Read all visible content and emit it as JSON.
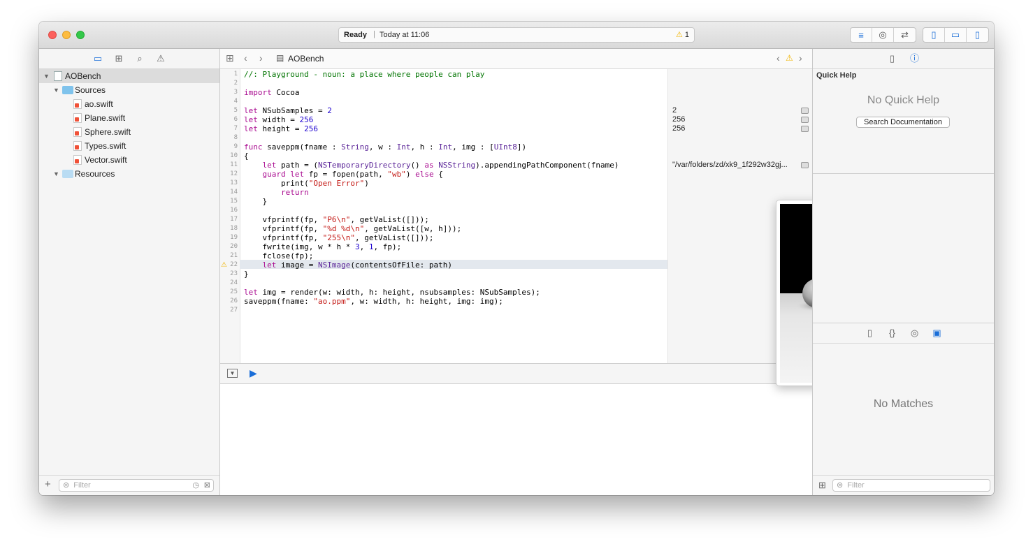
{
  "titlebar": {
    "status_ready": "Ready",
    "status_time": "Today at 11:06",
    "warning_count": "1"
  },
  "navigator": {
    "items": [
      {
        "label": "AOBench",
        "type": "project"
      },
      {
        "label": "Sources",
        "type": "folder"
      },
      {
        "label": "ao.swift",
        "type": "swift"
      },
      {
        "label": "Plane.swift",
        "type": "swift"
      },
      {
        "label": "Sphere.swift",
        "type": "swift"
      },
      {
        "label": "Types.swift",
        "type": "swift"
      },
      {
        "label": "Vector.swift",
        "type": "swift"
      },
      {
        "label": "Resources",
        "type": "folder"
      }
    ],
    "filter_placeholder": "Filter"
  },
  "editor": {
    "jumpbar_file": "AOBench",
    "lines": [
      "//: Playground - noun: a place where people can play",
      "",
      "import Cocoa",
      "",
      "let NSubSamples = 2",
      "let width = 256",
      "let height = 256",
      "",
      "func saveppm(fname : String, w : Int, h : Int, img : [UInt8])",
      "{",
      "    let path = (NSTemporaryDirectory() as NSString).appendingPathComponent(fname)",
      "    guard let fp = fopen(path, \"wb\") else {",
      "        print(\"Open Error\")",
      "        return",
      "    }",
      "",
      "    vfprintf(fp, \"P6\\n\", getVaList([]));",
      "    vfprintf(fp, \"%d %d\\n\", getVaList([w, h]));",
      "    vfprintf(fp, \"255\\n\", getVaList([]));",
      "    fwrite(img, w * h * 3, 1, fp);",
      "    fclose(fp);",
      "    let image = NSImage(contentsOfFile: path)",
      "}",
      "",
      "let img = render(w: width, h: height, nsubsamples: NSubSamples);",
      "saveppm(fname: \"ao.ppm\", w: width, h: height, img: img);",
      ""
    ],
    "results": [
      {
        "line": 5,
        "text": "2"
      },
      {
        "line": 6,
        "text": "256"
      },
      {
        "line": 7,
        "text": "256"
      },
      {
        "line": 11,
        "text": "\"/var/folders/zd/xk9_1f292w32gj..."
      },
      {
        "line": 25,
        "text": "),..."
      }
    ]
  },
  "inspector": {
    "quick_help_title": "Quick Help",
    "no_quick_help": "No Quick Help",
    "search_documentation": "Search Documentation",
    "no_matches": "No Matches",
    "filter_placeholder": "Filter"
  }
}
